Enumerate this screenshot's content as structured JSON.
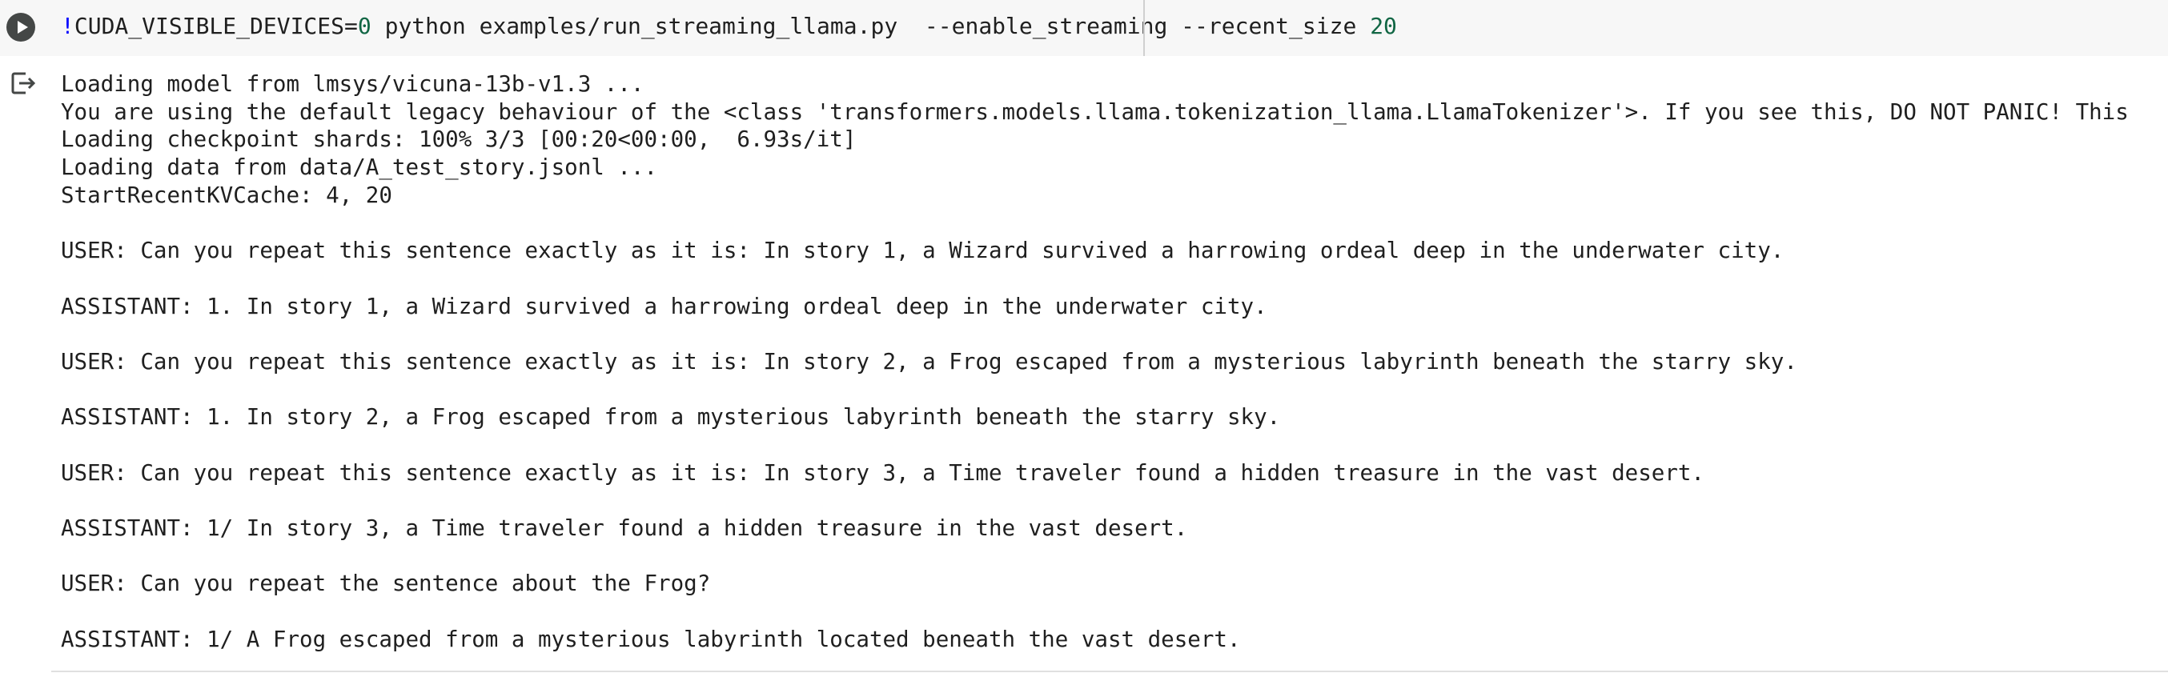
{
  "cell": {
    "command_prefix": "!",
    "command_text": "CUDA_VISIBLE_DEVICES=",
    "command_device": "0",
    "command_rest": " python examples/run_streaming_llama.py  --enable_streaming --recent_size ",
    "command_size": "20"
  },
  "output": {
    "lines": [
      "Loading model from lmsys/vicuna-13b-v1.3 ...",
      "You are using the default legacy behaviour of the <class 'transformers.models.llama.tokenization_llama.LlamaTokenizer'>. If you see this, DO NOT PANIC! This",
      "Loading checkpoint shards: 100% 3/3 [00:20<00:00,  6.93s/it]",
      "Loading data from data/A_test_story.jsonl ...",
      "StartRecentKVCache: 4, 20",
      "",
      "USER: Can you repeat this sentence exactly as it is: In story 1, a Wizard survived a harrowing ordeal deep in the underwater city.",
      "",
      "ASSISTANT: 1. In story 1, a Wizard survived a harrowing ordeal deep in the underwater city.",
      "",
      "USER: Can you repeat this sentence exactly as it is: In story 2, a Frog escaped from a mysterious labyrinth beneath the starry sky.",
      "",
      "ASSISTANT: 1. In story 2, a Frog escaped from a mysterious labyrinth beneath the starry sky.",
      "",
      "USER: Can you repeat this sentence exactly as it is: In story 3, a Time traveler found a hidden treasure in the vast desert.",
      "",
      "ASSISTANT: 1/ In story 3, a Time traveler found a hidden treasure in the vast desert.",
      "",
      "USER: Can you repeat the sentence about the Frog?",
      "",
      "ASSISTANT: 1/ A Frog escaped from a mysterious labyrinth located beneath the vast desert."
    ]
  },
  "icons": {
    "run": "play-circle-icon",
    "output": "output-redirect-icon"
  },
  "colors": {
    "cell_background": "#f7f7f7",
    "run_button": "#444746",
    "bang": "#0000ff",
    "number": "#116644",
    "text": "#1f1f1f"
  }
}
